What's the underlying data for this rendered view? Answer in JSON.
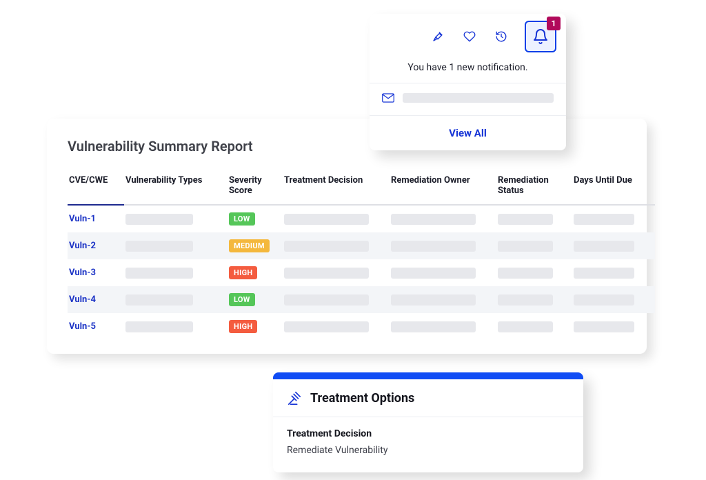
{
  "summary": {
    "title": "Vulnerability Summary Report",
    "columns": [
      "CVE/CWE",
      "Vulnerability Types",
      "Severity Score",
      "Treatment Decision",
      "Remediation Owner",
      "Remediation Status",
      "Days Until Due"
    ],
    "rows": [
      {
        "id": "Vuln-1",
        "severity": "LOW",
        "sev_class": "sev-low"
      },
      {
        "id": "Vuln-2",
        "severity": "MEDIUM",
        "sev_class": "sev-medium"
      },
      {
        "id": "Vuln-3",
        "severity": "HIGH",
        "sev_class": "sev-high"
      },
      {
        "id": "Vuln-4",
        "severity": "LOW",
        "sev_class": "sev-low"
      },
      {
        "id": "Vuln-5",
        "severity": "HIGH",
        "sev_class": "sev-high"
      }
    ]
  },
  "notification": {
    "badge_count": "1",
    "message": "You have 1 new notification.",
    "view_all": "View All",
    "icons": {
      "pin": "pin-icon",
      "heart": "heart-icon",
      "history": "history-icon",
      "bell": "bell-icon",
      "envelope": "envelope-icon"
    }
  },
  "treatment": {
    "title": "Treatment Options",
    "decision_label": "Treatment Decision",
    "decision_value": "Remediate Vulnerability",
    "icon": "gavel-icon"
  },
  "colors": {
    "accent": "#104cf4",
    "active_underline": "#1e2a8f",
    "link": "#1e35c6",
    "badge_red": "#b10a5b",
    "sev_low": "#55c659",
    "sev_medium": "#f4b83d",
    "sev_high": "#f45c3f"
  }
}
